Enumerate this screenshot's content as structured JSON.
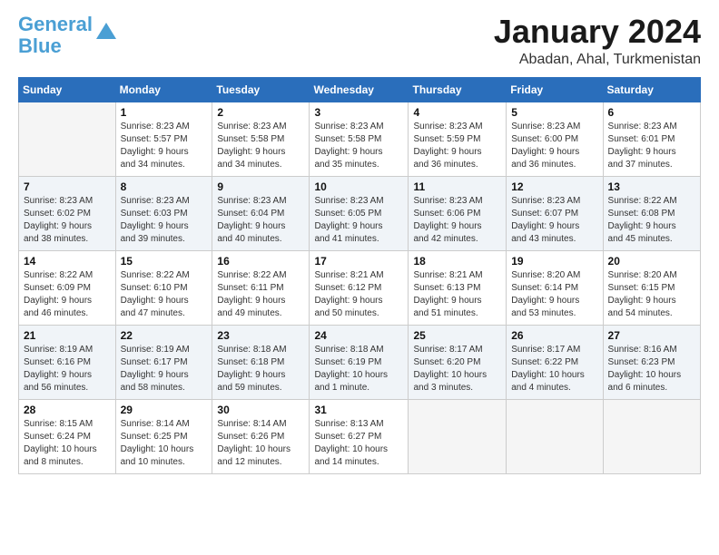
{
  "logo": {
    "line1": "General",
    "line2": "Blue"
  },
  "title": "January 2024",
  "location": "Abadan, Ahal, Turkmenistan",
  "days_of_week": [
    "Sunday",
    "Monday",
    "Tuesday",
    "Wednesday",
    "Thursday",
    "Friday",
    "Saturday"
  ],
  "weeks": [
    [
      {
        "day": "",
        "info": ""
      },
      {
        "day": "1",
        "info": "Sunrise: 8:23 AM\nSunset: 5:57 PM\nDaylight: 9 hours\nand 34 minutes."
      },
      {
        "day": "2",
        "info": "Sunrise: 8:23 AM\nSunset: 5:58 PM\nDaylight: 9 hours\nand 34 minutes."
      },
      {
        "day": "3",
        "info": "Sunrise: 8:23 AM\nSunset: 5:58 PM\nDaylight: 9 hours\nand 35 minutes."
      },
      {
        "day": "4",
        "info": "Sunrise: 8:23 AM\nSunset: 5:59 PM\nDaylight: 9 hours\nand 36 minutes."
      },
      {
        "day": "5",
        "info": "Sunrise: 8:23 AM\nSunset: 6:00 PM\nDaylight: 9 hours\nand 36 minutes."
      },
      {
        "day": "6",
        "info": "Sunrise: 8:23 AM\nSunset: 6:01 PM\nDaylight: 9 hours\nand 37 minutes."
      }
    ],
    [
      {
        "day": "7",
        "info": "Sunrise: 8:23 AM\nSunset: 6:02 PM\nDaylight: 9 hours\nand 38 minutes."
      },
      {
        "day": "8",
        "info": "Sunrise: 8:23 AM\nSunset: 6:03 PM\nDaylight: 9 hours\nand 39 minutes."
      },
      {
        "day": "9",
        "info": "Sunrise: 8:23 AM\nSunset: 6:04 PM\nDaylight: 9 hours\nand 40 minutes."
      },
      {
        "day": "10",
        "info": "Sunrise: 8:23 AM\nSunset: 6:05 PM\nDaylight: 9 hours\nand 41 minutes."
      },
      {
        "day": "11",
        "info": "Sunrise: 8:23 AM\nSunset: 6:06 PM\nDaylight: 9 hours\nand 42 minutes."
      },
      {
        "day": "12",
        "info": "Sunrise: 8:23 AM\nSunset: 6:07 PM\nDaylight: 9 hours\nand 43 minutes."
      },
      {
        "day": "13",
        "info": "Sunrise: 8:22 AM\nSunset: 6:08 PM\nDaylight: 9 hours\nand 45 minutes."
      }
    ],
    [
      {
        "day": "14",
        "info": "Sunrise: 8:22 AM\nSunset: 6:09 PM\nDaylight: 9 hours\nand 46 minutes."
      },
      {
        "day": "15",
        "info": "Sunrise: 8:22 AM\nSunset: 6:10 PM\nDaylight: 9 hours\nand 47 minutes."
      },
      {
        "day": "16",
        "info": "Sunrise: 8:22 AM\nSunset: 6:11 PM\nDaylight: 9 hours\nand 49 minutes."
      },
      {
        "day": "17",
        "info": "Sunrise: 8:21 AM\nSunset: 6:12 PM\nDaylight: 9 hours\nand 50 minutes."
      },
      {
        "day": "18",
        "info": "Sunrise: 8:21 AM\nSunset: 6:13 PM\nDaylight: 9 hours\nand 51 minutes."
      },
      {
        "day": "19",
        "info": "Sunrise: 8:20 AM\nSunset: 6:14 PM\nDaylight: 9 hours\nand 53 minutes."
      },
      {
        "day": "20",
        "info": "Sunrise: 8:20 AM\nSunset: 6:15 PM\nDaylight: 9 hours\nand 54 minutes."
      }
    ],
    [
      {
        "day": "21",
        "info": "Sunrise: 8:19 AM\nSunset: 6:16 PM\nDaylight: 9 hours\nand 56 minutes."
      },
      {
        "day": "22",
        "info": "Sunrise: 8:19 AM\nSunset: 6:17 PM\nDaylight: 9 hours\nand 58 minutes."
      },
      {
        "day": "23",
        "info": "Sunrise: 8:18 AM\nSunset: 6:18 PM\nDaylight: 9 hours\nand 59 minutes."
      },
      {
        "day": "24",
        "info": "Sunrise: 8:18 AM\nSunset: 6:19 PM\nDaylight: 10 hours\nand 1 minute."
      },
      {
        "day": "25",
        "info": "Sunrise: 8:17 AM\nSunset: 6:20 PM\nDaylight: 10 hours\nand 3 minutes."
      },
      {
        "day": "26",
        "info": "Sunrise: 8:17 AM\nSunset: 6:22 PM\nDaylight: 10 hours\nand 4 minutes."
      },
      {
        "day": "27",
        "info": "Sunrise: 8:16 AM\nSunset: 6:23 PM\nDaylight: 10 hours\nand 6 minutes."
      }
    ],
    [
      {
        "day": "28",
        "info": "Sunrise: 8:15 AM\nSunset: 6:24 PM\nDaylight: 10 hours\nand 8 minutes."
      },
      {
        "day": "29",
        "info": "Sunrise: 8:14 AM\nSunset: 6:25 PM\nDaylight: 10 hours\nand 10 minutes."
      },
      {
        "day": "30",
        "info": "Sunrise: 8:14 AM\nSunset: 6:26 PM\nDaylight: 10 hours\nand 12 minutes."
      },
      {
        "day": "31",
        "info": "Sunrise: 8:13 AM\nSunset: 6:27 PM\nDaylight: 10 hours\nand 14 minutes."
      },
      {
        "day": "",
        "info": ""
      },
      {
        "day": "",
        "info": ""
      },
      {
        "day": "",
        "info": ""
      }
    ]
  ]
}
